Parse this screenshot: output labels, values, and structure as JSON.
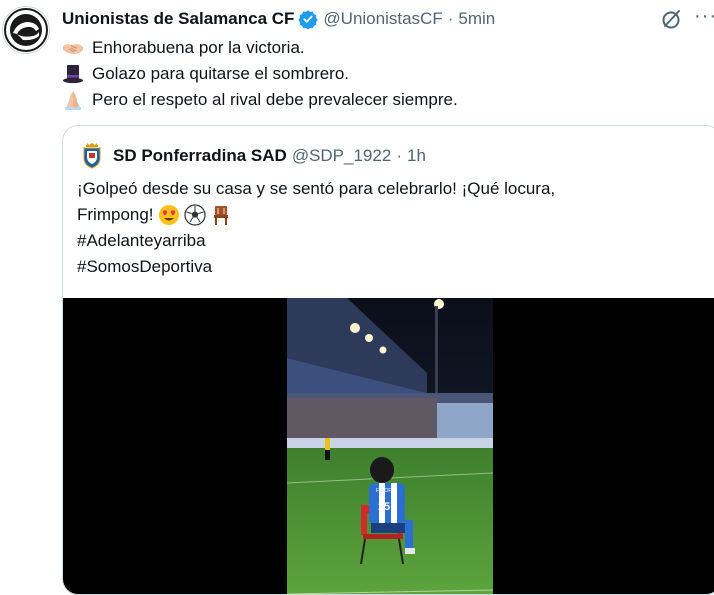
{
  "tweet": {
    "author_name": "Unionistas de Salamanca CF",
    "handle": "@UnionistasCF",
    "separator": "·",
    "time": "5min",
    "lines": [
      {
        "emoji": "handshake-emoji",
        "text": "Enhorabuena por la victoria."
      },
      {
        "emoji": "top-hat-emoji",
        "text": "Golazo para quitarse el sombrero."
      },
      {
        "emoji": "folded-hands-emoji",
        "text": "Pero el respeto al rival debe prevalecer siempre."
      }
    ]
  },
  "quoted": {
    "author_name": "SD Ponferradina SAD",
    "handle": "@SDP_1922",
    "separator": "·",
    "time": "1h",
    "line1": "¡Golpeó desde su casa y se sentó para celebrarlo! ¡Qué locura,",
    "line2": "Frimpong!",
    "line2_emojis": [
      "heart-eyes-emoji",
      "soccer-ball-emoji",
      "chair-emoji"
    ],
    "hashtag1": "#Adelanteyarriba",
    "hashtag2": "#SomosDeportiva",
    "media": {
      "type": "video",
      "player_number": "15",
      "player_name": "F. SOFÍA"
    }
  },
  "colors": {
    "text": "#0f1419",
    "secondary": "#536471",
    "border": "#cfd9de",
    "verified": "#1d9bf0",
    "hashtag": "#0f1419"
  }
}
